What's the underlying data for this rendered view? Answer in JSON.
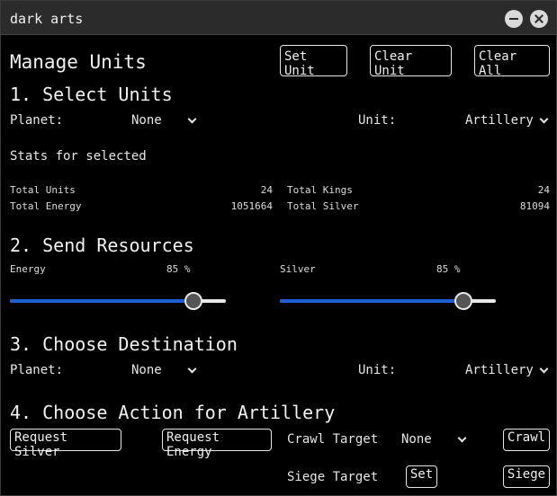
{
  "window": {
    "title": "dark arts"
  },
  "header": {
    "title": "Manage Units",
    "set_unit": "Set Unit",
    "clear_unit": "Clear Unit",
    "clear_all": "Clear All"
  },
  "select_units": {
    "heading": "1. Select Units",
    "planet_label": "Planet:",
    "planet_value": "None",
    "unit_label": "Unit:",
    "unit_value": "Artillery",
    "stats_label": "Stats for selected",
    "total_units_label": "Total Units",
    "total_units_value": "24",
    "total_kings_label": "Total Kings",
    "total_kings_value": "24",
    "total_energy_label": "Total Energy",
    "total_energy_value": "1051664",
    "total_silver_label": "Total Silver",
    "total_silver_value": "81094"
  },
  "send_resources": {
    "heading": "2. Send Resources",
    "energy_label": "Energy",
    "energy_pct": "85 %",
    "energy_fraction": 0.85,
    "silver_label": "Silver",
    "silver_pct": "85 %",
    "silver_fraction": 0.85,
    "accent": "#1e5fd6"
  },
  "destination": {
    "heading": "3. Choose Destination",
    "planet_label": "Planet:",
    "planet_value": "None",
    "unit_label": "Unit:",
    "unit_value": "Artillery"
  },
  "action": {
    "heading": "4. Choose Action for Artillery",
    "request_silver": "Request Silver",
    "request_energy": "Request Energy",
    "crawl_target_label": "Crawl Target",
    "crawl_target_value": "None",
    "crawl_button": "Crawl",
    "siege_target_label": "Siege Target",
    "set_button": "Set",
    "siege_button": "Siege"
  }
}
